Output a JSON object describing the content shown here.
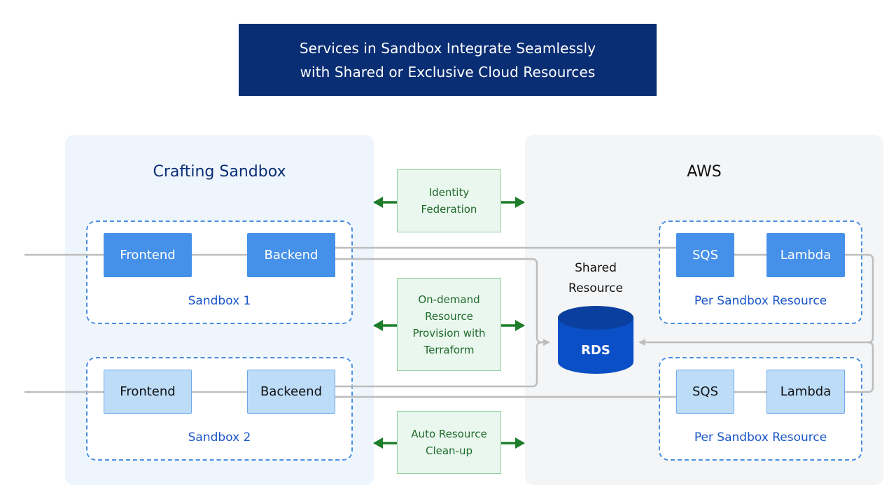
{
  "title": {
    "line1": "Services in Sandbox Integrate Seamlessly",
    "line2": "with Shared or Exclusive Cloud Resources"
  },
  "colors": {
    "title_bg": "#0a2e74",
    "sandbox_panel_bg": "#eef5fd",
    "aws_panel_bg": "#f4f5f7",
    "service_dark": "#4590e8",
    "service_light": "#bcdcf8",
    "group_label": "#1a56c8",
    "arrow_green": "#1e7d2a",
    "connector_gray": "#bdbdbd",
    "rds_blue": "#0b4fc7"
  },
  "left_panel": {
    "title": "Crafting Sandbox",
    "sandboxes": [
      {
        "label": "Sandbox 1",
        "style": "dark",
        "services": [
          "Frontend",
          "Backend"
        ]
      },
      {
        "label": "Sandbox 2",
        "style": "light",
        "services": [
          "Frontend",
          "Backeend"
        ]
      }
    ]
  },
  "middle": {
    "features": [
      {
        "lines": [
          "Identity",
          "Federation"
        ]
      },
      {
        "lines": [
          "On-demand",
          "Resource",
          "Provision with",
          "Terraform"
        ]
      },
      {
        "lines": [
          "Auto Resource",
          "Clean-up"
        ]
      }
    ]
  },
  "right_panel": {
    "title": "AWS",
    "shared": {
      "label_lines": [
        "Shared",
        "Resource"
      ],
      "db": "RDS"
    },
    "groups": [
      {
        "label": "Per Sandbox Resource",
        "style": "dark",
        "services": [
          "SQS",
          "Lambda"
        ]
      },
      {
        "label": "Per Sandbox Resource",
        "style": "light",
        "services": [
          "SQS",
          "Lambda"
        ]
      }
    ]
  }
}
